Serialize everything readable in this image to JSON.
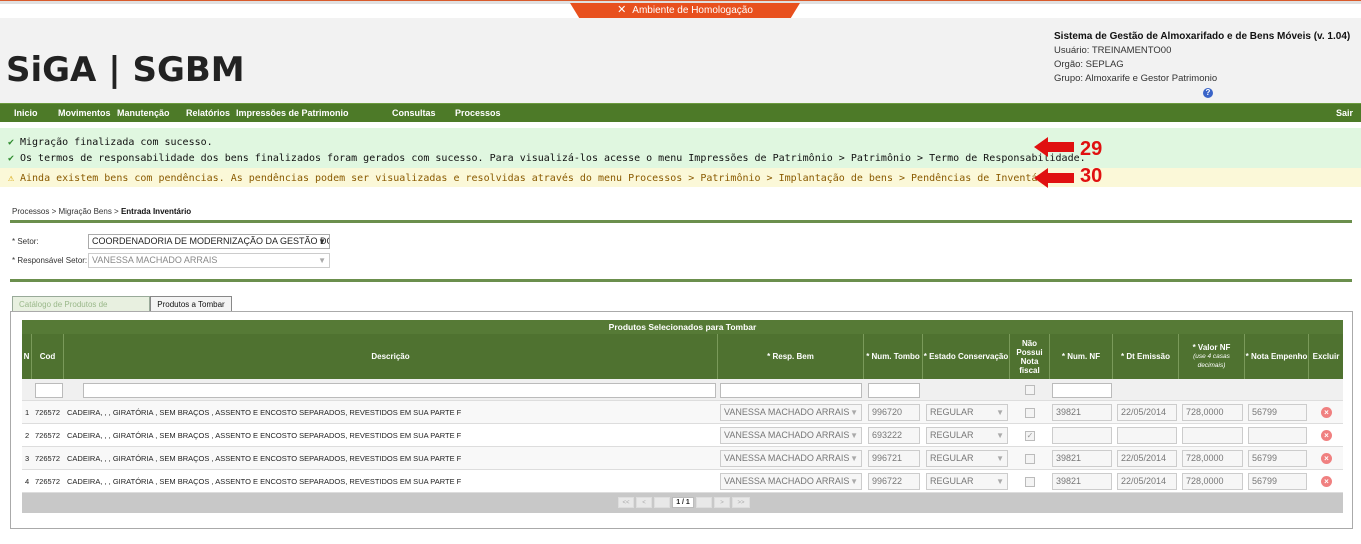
{
  "env_banner": "Ambiente de Homologação",
  "logo": {
    "part1": "SiGA",
    "part2": "SGBM",
    "separator": "|"
  },
  "system": {
    "title": "Sistema de Gestão de Almoxarifado e de Bens Móveis (v. 1.04)",
    "usuario": "Usuário: TREINAMENTO00",
    "orgao": "Orgão: SEPLAG",
    "grupo": "Grupo: Almoxarife e Gestor Patrimonio"
  },
  "menu": [
    "Inicio",
    "Movimentos",
    "Manutenção",
    "Relatórios",
    "Impressões de Patrimonio",
    "Consultas",
    "Processos"
  ],
  "menu_exit": "Sair",
  "messages": {
    "success1": "Migração finalizada com sucesso.",
    "success2": "Os termos de responsabilidade dos bens finalizados foram gerados com sucesso. Para visualizá-los acesse o menu Impressões de Patrimônio > Patrimônio > Termo de Responsabilidade.",
    "warning": "Ainda existem bens com pendências. As pendências podem ser visualizadas e resolvidas através do menu Processos > Patrimônio > Implantação de bens > Pendências de Inventário."
  },
  "annotations": [
    "29",
    "30"
  ],
  "breadcrumb": {
    "path": "Processos  > Migração Bens  > ",
    "current": "Entrada Inventário"
  },
  "form": {
    "setor_label": "* Setor:",
    "setor_value": "COORDENADORIA DE MODERNIZAÇÃO DA GESTÃO DO",
    "resp_label": "* Responsável Setor:",
    "resp_value": "VANESSA MACHADO ARRAIS"
  },
  "tabs": [
    "Catálogo de Produtos de Patrimônio",
    "Produtos a Tombar"
  ],
  "grid": {
    "title": "Produtos Selecionados para Tombar",
    "headers": {
      "n": "N",
      "cod": "Cod",
      "desc": "Descrição",
      "resp": "* Resp. Bem",
      "tombo": "* Num. Tombo",
      "estado": "* Estado Conservação",
      "nonota": "Não Possui Nota fiscal",
      "numnf": "* Num. NF",
      "dtemissao": "* Dt Emissão",
      "valornf": "* Valor NF",
      "valornf_hint": "(use 4 casas decimais)",
      "empenho": "* Nota Empenho",
      "excluir": "Excluir"
    },
    "rows": [
      {
        "n": "1",
        "cod": "726572",
        "desc": "CADEIRA, , , GIRATÓRIA , SEM BRAÇOS , ASSENTO E ENCOSTO SEPARADOS, REVESTIDOS EM SUA PARTE F",
        "resp": "VANESSA MACHADO ARRAIS",
        "tombo": "996720",
        "estado": "REGULAR",
        "nonota": false,
        "numnf": "39821",
        "dt": "22/05/2014",
        "valor": "728,0000",
        "empenho": "56799"
      },
      {
        "n": "2",
        "cod": "726572",
        "desc": "CADEIRA, , , GIRATÓRIA , SEM BRAÇOS , ASSENTO E ENCOSTO SEPARADOS, REVESTIDOS EM SUA PARTE F",
        "resp": "VANESSA MACHADO ARRAIS",
        "tombo": "693222",
        "estado": "REGULAR",
        "nonota": true,
        "numnf": "",
        "dt": "",
        "valor": "",
        "empenho": ""
      },
      {
        "n": "3",
        "cod": "726572",
        "desc": "CADEIRA, , , GIRATÓRIA , SEM BRAÇOS , ASSENTO E ENCOSTO SEPARADOS, REVESTIDOS EM SUA PARTE F",
        "resp": "VANESSA MACHADO ARRAIS",
        "tombo": "996721",
        "estado": "REGULAR",
        "nonota": false,
        "numnf": "39821",
        "dt": "22/05/2014",
        "valor": "728,0000",
        "empenho": "56799"
      },
      {
        "n": "4",
        "cod": "726572",
        "desc": "CADEIRA, , , GIRATÓRIA , SEM BRAÇOS , ASSENTO E ENCOSTO SEPARADOS, REVESTIDOS EM SUA PARTE F",
        "resp": "VANESSA MACHADO ARRAIS",
        "tombo": "996722",
        "estado": "REGULAR",
        "nonota": false,
        "numnf": "39821",
        "dt": "22/05/2014",
        "valor": "728,0000",
        "empenho": "56799"
      }
    ],
    "pager": {
      "first": "<<",
      "prev": "<",
      "info": "1 / 1",
      "next": ">",
      "last": ">>"
    }
  },
  "colors": {
    "menu_bg": "#4d7a28",
    "env_tab": "#e8501e",
    "success_bg": "#e0f7e0",
    "warning_bg": "#fbf8d8",
    "annotation": "#e01010"
  },
  "icons": {
    "env": "tools-icon",
    "success": "check-icon",
    "warning": "warning-icon",
    "help": "help-icon",
    "delete": "delete-icon",
    "annotation": "arrow-left-icon"
  }
}
